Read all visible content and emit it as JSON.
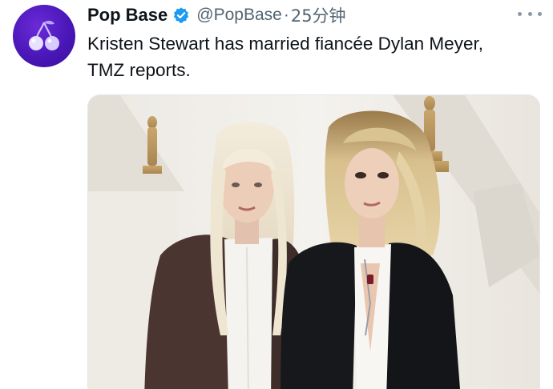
{
  "tweet": {
    "author": {
      "display_name": "Pop Base",
      "handle": "@PopBase",
      "verified": true,
      "avatar_icon": "cherries-icon",
      "avatar_color": "#4a17b8"
    },
    "separator": "·",
    "timestamp": "25分钟",
    "text": "Kristen Stewart has married fiancée Dylan Meyer, TMZ reports.",
    "more_icon": "more-options-icon",
    "verified_color": "#1d9bf0"
  }
}
